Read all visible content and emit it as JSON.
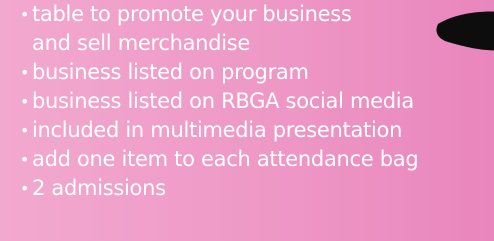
{
  "benefits": [
    {
      "bullet": "•",
      "lines": [
        "table to promote your business",
        "and sell merchandise"
      ]
    },
    {
      "bullet": "•",
      "lines": [
        "business listed on program"
      ]
    },
    {
      "bullet": "•",
      "lines": [
        "business listed on RBGA social media"
      ]
    },
    {
      "bullet": "•",
      "lines": [
        "included in multimedia presentation"
      ]
    },
    {
      "bullet": "•",
      "lines": [
        "add one item to each attendance bag"
      ]
    },
    {
      "bullet": "•",
      "lines": [
        "2 admissions"
      ]
    }
  ],
  "colors": {
    "text": "#ffffff",
    "decoration": "#0d0d0d"
  }
}
